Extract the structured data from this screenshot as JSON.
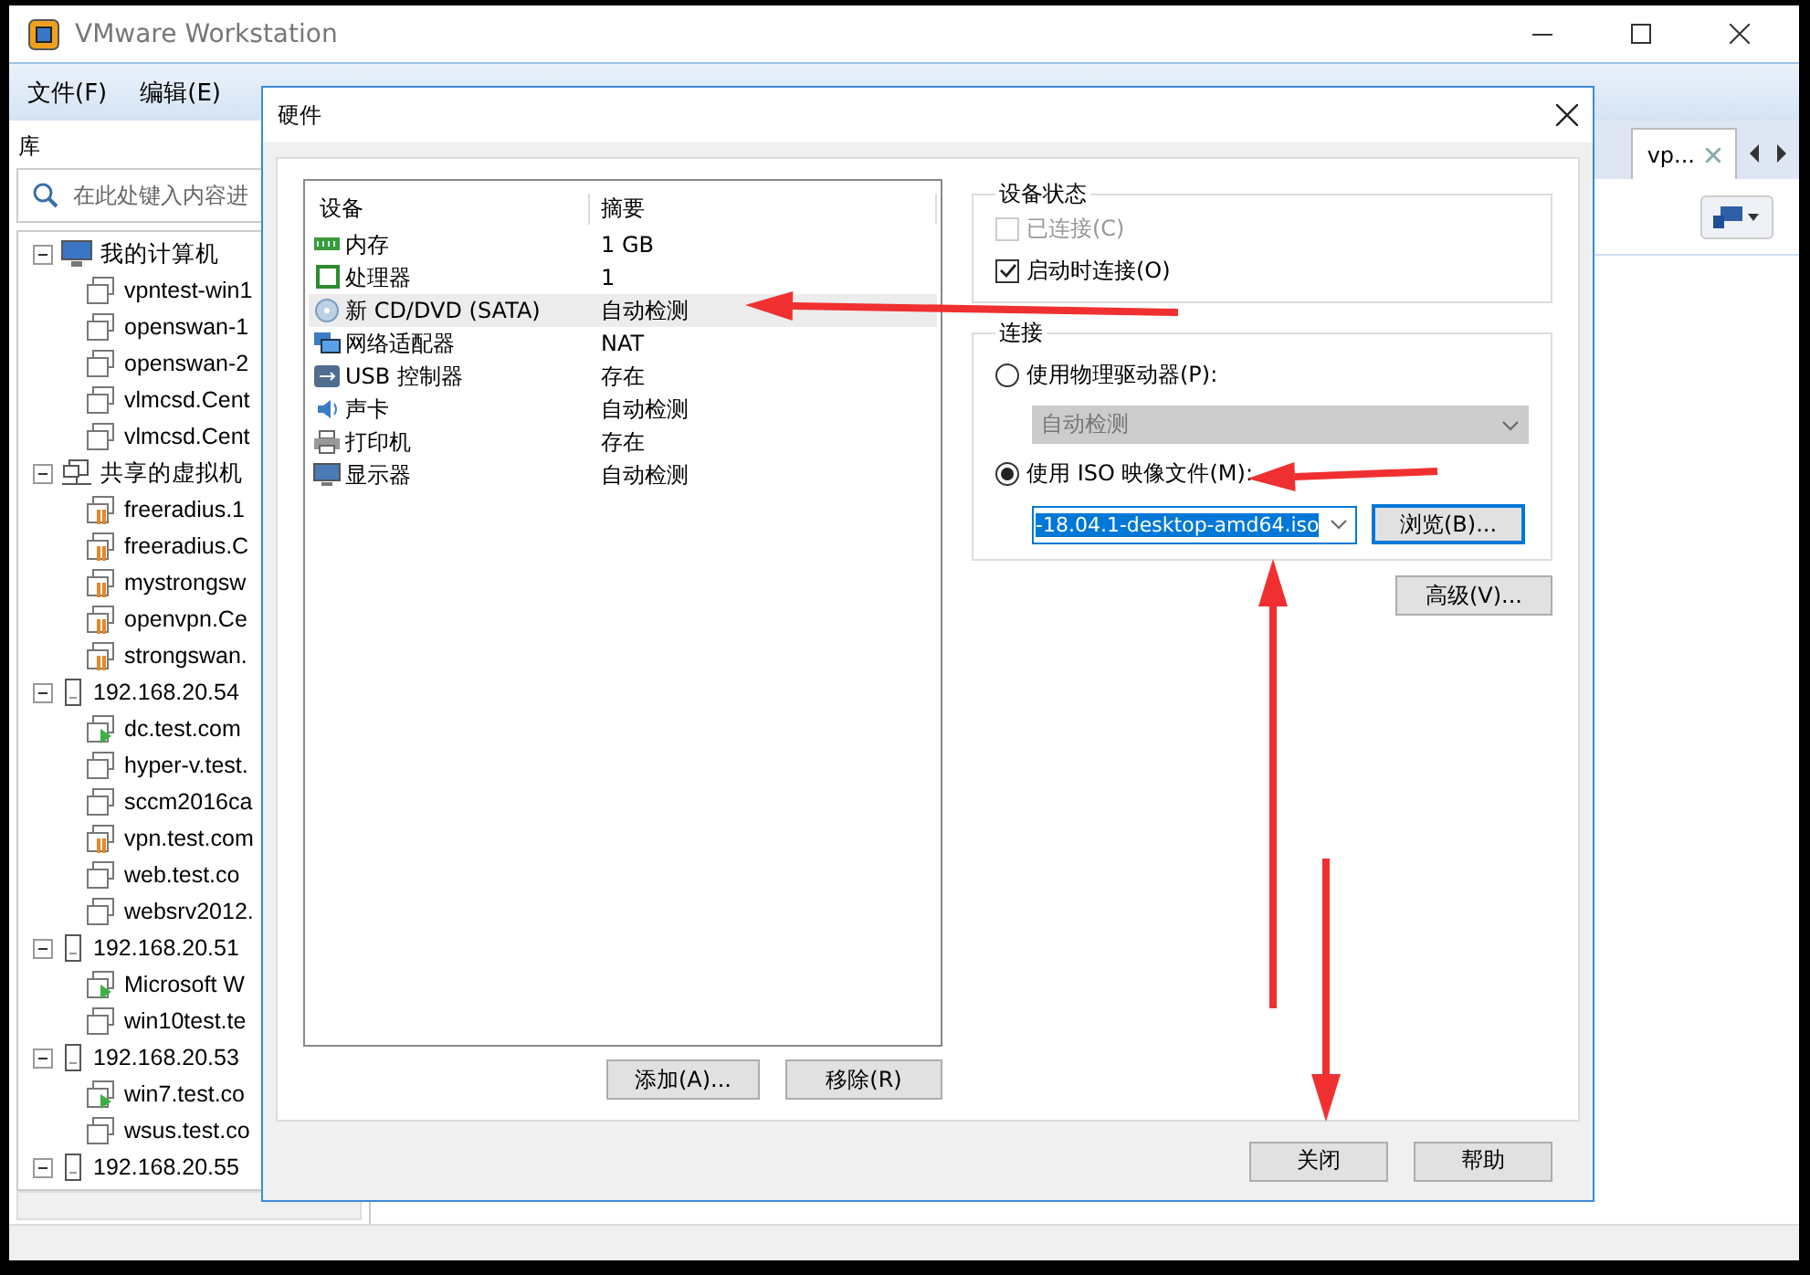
{
  "window": {
    "title": "VMware Workstation"
  },
  "menu": [
    "文件(F)",
    "编辑(E)"
  ],
  "sidebar": {
    "title": "库",
    "search_placeholder": "在此处键入内容进",
    "tree": [
      {
        "label": "我的计算机",
        "kind": "computer",
        "expanded": true,
        "children": [
          {
            "label": "vpntest-win1",
            "kind": "vm"
          },
          {
            "label": "openswan-1",
            "kind": "vm"
          },
          {
            "label": "openswan-2",
            "kind": "vm"
          },
          {
            "label": "vlmcsd.Cent",
            "kind": "vm"
          },
          {
            "label": "vlmcsd.Cent",
            "kind": "vm"
          }
        ]
      },
      {
        "label": "共享的虚拟机",
        "kind": "shared",
        "expanded": true,
        "children": [
          {
            "label": "freeradius.1",
            "kind": "shared-vm"
          },
          {
            "label": "freeradius.C",
            "kind": "shared-vm"
          },
          {
            "label": "mystrongsw",
            "kind": "shared-vm"
          },
          {
            "label": "openvpn.Ce",
            "kind": "shared-vm"
          },
          {
            "label": "strongswan.",
            "kind": "shared-vm"
          }
        ]
      },
      {
        "label": "192.168.20.54",
        "kind": "host",
        "expanded": true,
        "children": [
          {
            "label": "dc.test.com",
            "kind": "running-vm"
          },
          {
            "label": "hyper-v.test.",
            "kind": "vm"
          },
          {
            "label": "sccm2016ca",
            "kind": "vm"
          },
          {
            "label": "vpn.test.com",
            "kind": "shared-vm"
          },
          {
            "label": "web.test.co",
            "kind": "vm"
          },
          {
            "label": "websrv2012.",
            "kind": "vm"
          }
        ]
      },
      {
        "label": "192.168.20.51",
        "kind": "host",
        "expanded": true,
        "children": [
          {
            "label": "Microsoft W",
            "kind": "running-vm"
          },
          {
            "label": "win10test.te",
            "kind": "vm"
          }
        ]
      },
      {
        "label": "192.168.20.53",
        "kind": "host",
        "expanded": true,
        "children": [
          {
            "label": "win7.test.co",
            "kind": "running-vm"
          },
          {
            "label": "wsus.test.co",
            "kind": "vm"
          }
        ]
      },
      {
        "label": "192.168.20.55",
        "kind": "host",
        "expanded": true
      }
    ]
  },
  "tabs": [
    {
      "label": "vp...",
      "selected": true
    }
  ],
  "dialog": {
    "title": "硬件",
    "columns": [
      "设备",
      "摘要"
    ],
    "devices": [
      {
        "kind": "memory",
        "name": "内存",
        "summary": "1 GB",
        "selected": false
      },
      {
        "kind": "cpu",
        "name": "处理器",
        "summary": "1",
        "selected": false
      },
      {
        "kind": "cdrom",
        "name": "新 CD/DVD (SATA)",
        "summary": "自动检测",
        "selected": true
      },
      {
        "kind": "network",
        "name": "网络适配器",
        "summary": "NAT",
        "selected": false
      },
      {
        "kind": "usb",
        "name": "USB 控制器",
        "summary": "存在",
        "selected": false
      },
      {
        "kind": "sound",
        "name": "声卡",
        "summary": "自动检测",
        "selected": false
      },
      {
        "kind": "printer",
        "name": "打印机",
        "summary": "存在",
        "selected": false
      },
      {
        "kind": "display",
        "name": "显示器",
        "summary": "自动检测",
        "selected": false
      }
    ],
    "list_buttons": [
      "添加(A)...",
      "移除(R)"
    ],
    "device_status": {
      "title": "设备状态",
      "options": [
        {
          "label": "已连接(C)",
          "checked": false,
          "disabled": true
        },
        {
          "label": "启动时连接(O)",
          "checked": true,
          "disabled": false
        }
      ]
    },
    "connection": {
      "title": "连接",
      "physical": {
        "label": "使用物理驱动器(P):",
        "selected": false,
        "value": "自动检测",
        "disabled": true
      },
      "iso": {
        "label": "使用 ISO 映像文件(M):",
        "selected": true,
        "value": "-18.04.1-desktop-amd64.iso"
      },
      "browse": "浏览(B)...",
      "advanced": "高级(V)..."
    },
    "footer_buttons": [
      "关闭",
      "帮助"
    ]
  }
}
